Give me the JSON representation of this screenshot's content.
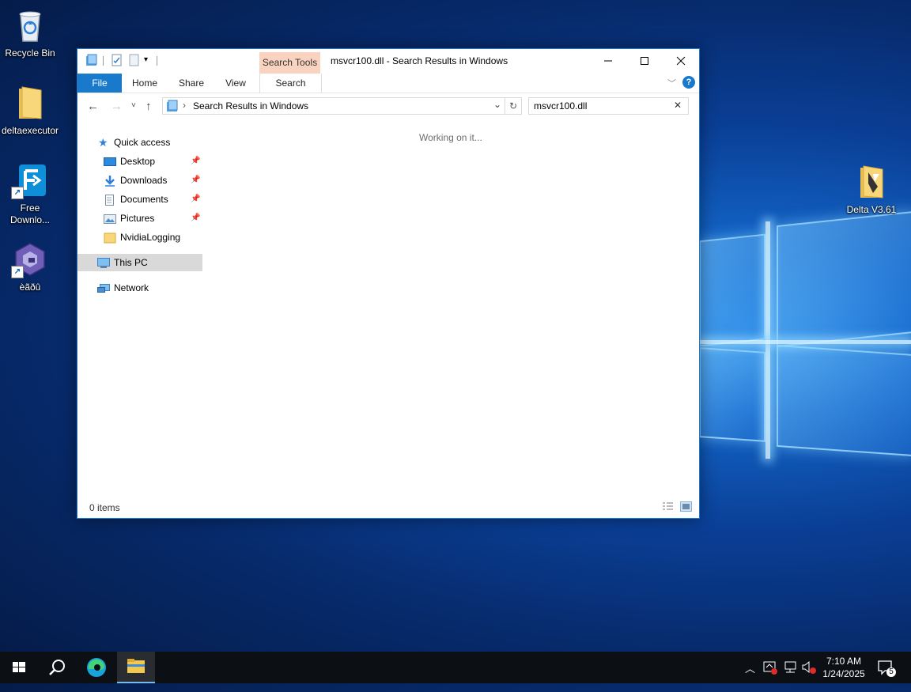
{
  "desktop": {
    "icons": [
      {
        "label": "Recycle Bin"
      },
      {
        "label": "deltaexecutor"
      },
      {
        "label": "Free Downlo..."
      },
      {
        "label": "èãðû"
      },
      {
        "label": "Delta V3.61"
      }
    ]
  },
  "explorer": {
    "title": "msvcr100.dll - Search Results in Windows",
    "context_tab": "Search Tools",
    "ribbon_tabs": [
      "File",
      "Home",
      "Share",
      "View",
      "Search"
    ],
    "address": "Search Results in Windows",
    "search_value": "msvcr100.dll",
    "nav": {
      "quick_access": "Quick access",
      "items": [
        "Desktop",
        "Downloads",
        "Documents",
        "Pictures",
        "NvidiaLogging"
      ],
      "this_pc": "This PC",
      "network": "Network"
    },
    "working_text": "Working on it...",
    "status_text": "0 items"
  },
  "taskbar": {
    "time": "7:10 AM",
    "date": "1/24/2025",
    "notification_count": "5"
  },
  "colors": {
    "accent": "#1979ca",
    "context_tab": "#f9d3c0",
    "taskbar": "#0c0f14"
  }
}
